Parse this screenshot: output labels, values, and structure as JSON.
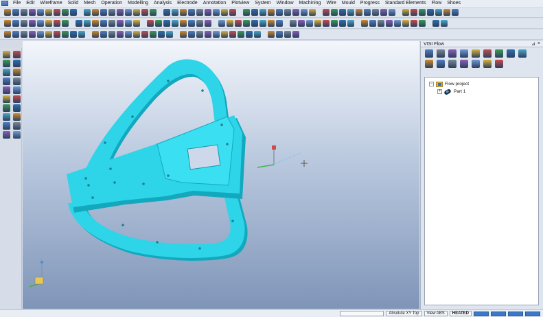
{
  "menubar": {
    "items": [
      "File",
      "Edit",
      "Wireframe",
      "Solid",
      "Mesh",
      "Operation",
      "Modelling",
      "Analysis",
      "Electrode",
      "Annotation",
      "Plotview",
      "System",
      "Window",
      "Machining",
      "Wire",
      "Mould",
      "Progress",
      "Standard Elements",
      "Flow",
      "Shoes"
    ]
  },
  "panel": {
    "title": "VISI Flow",
    "pin": "⊿",
    "close": "×"
  },
  "tree": {
    "root_toggle": "−",
    "root": "Flow project",
    "child_toggle": "+",
    "child": "Part 1"
  },
  "status": {
    "view_mode": "Absolute XY Top",
    "view_type": "View ABS",
    "state": "HEATED"
  },
  "colors": {
    "part": "#2ed4e8",
    "part_shadow": "#12a9bf",
    "accent": "#3c78c8"
  },
  "icons": {
    "new": "new-file-icon",
    "open": "open-folder-icon",
    "save": "save-icon"
  }
}
